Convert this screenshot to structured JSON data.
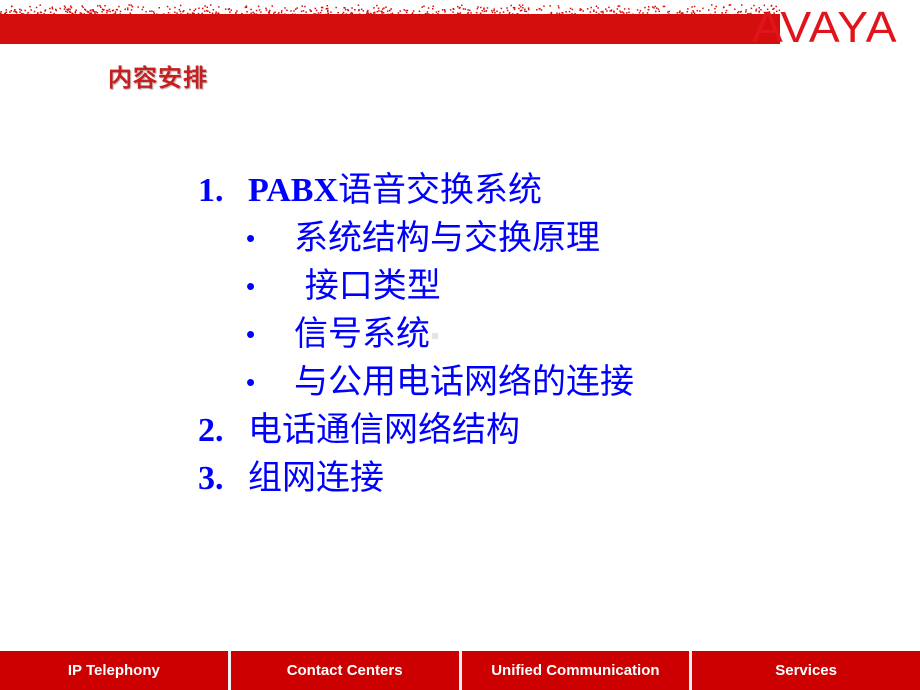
{
  "header": {
    "brand_logo": "AVAYA",
    "brand_color": "#e0141a",
    "banner_color": "#d40d0d"
  },
  "section_title": "内容安排",
  "outline": [
    {
      "number": "1.",
      "latin_prefix": "PABX",
      "text": "语音交换系统",
      "sub_items": [
        {
          "bullet": "•",
          "text": "系统结构与交换原理"
        },
        {
          "bullet": "•",
          "text": " 接口类型"
        },
        {
          "bullet": "•",
          "text": "信号系统"
        },
        {
          "bullet": "•",
          "text": "与公用电话网络的连接"
        }
      ]
    },
    {
      "number": "2.",
      "text": "电话通信网络结构"
    },
    {
      "number": "3.",
      "text": "组网连接"
    }
  ],
  "text_color": "#0000ff",
  "footer": {
    "items": [
      {
        "label": "IP Telephony"
      },
      {
        "label": "Contact Centers"
      },
      {
        "label": "Unified Communication"
      },
      {
        "label": "Services"
      }
    ],
    "color": "#cc0000"
  }
}
